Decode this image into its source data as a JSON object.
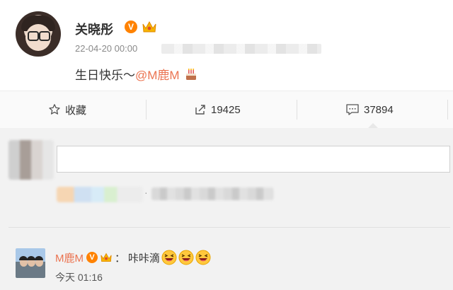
{
  "post": {
    "username": "关晓彤",
    "verified_badge": "V",
    "timestamp": "22-04-20 00:00",
    "text_prefix": "生日快乐～",
    "mention": "@M鹿M",
    "icons": {
      "avatar": "user-avatar-icon",
      "verified": "verified-badge-icon",
      "crown": "vip-crown-icon",
      "cake": "cake-emoji-icon"
    }
  },
  "actions": {
    "favorite_label": "收藏",
    "repost_count": "19425",
    "comment_count": "37894",
    "icons": {
      "favorite": "star-icon",
      "repost": "repost-icon",
      "comment": "comment-icon"
    }
  },
  "comment_box": {
    "placeholder": ""
  },
  "reply": {
    "username": "M鹿M",
    "verified_badge": "V",
    "separator": "：",
    "text": "咔咔滴",
    "time": "今天 01:16",
    "emoji_icon": "laughing-emoji-icon"
  },
  "colors": {
    "accent_orange": "#eb7350",
    "verified_orange": "#ff8200",
    "comment_bg": "#f2f2f2",
    "action_bar_bg": "#fafafa"
  }
}
